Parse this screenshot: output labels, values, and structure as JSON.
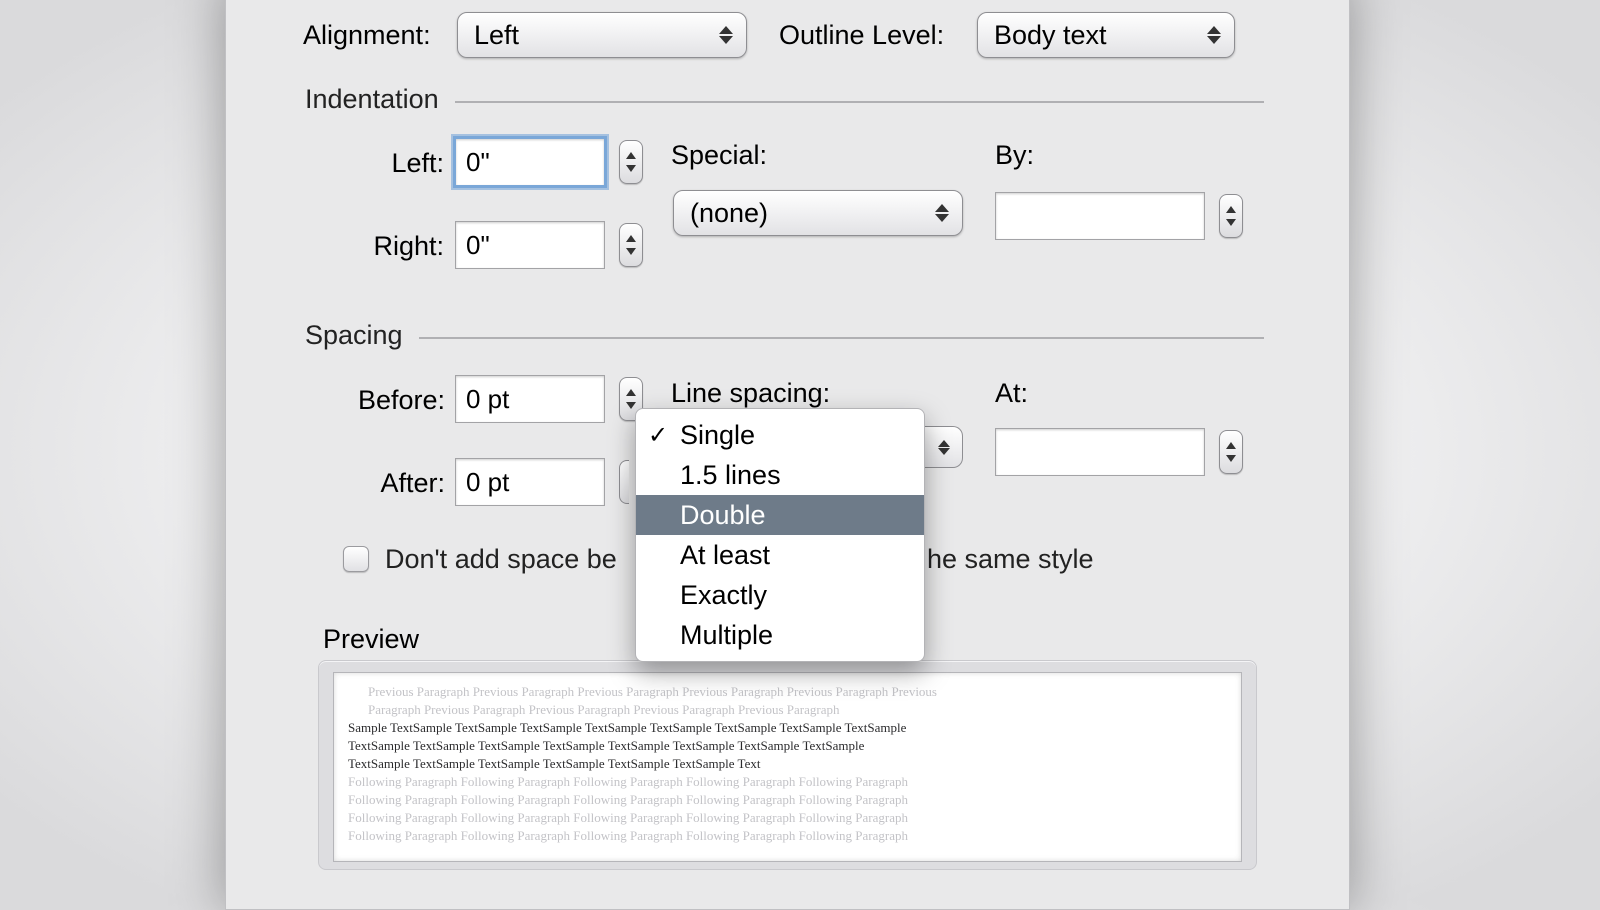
{
  "alignment": {
    "label": "Alignment:",
    "value": "Left"
  },
  "outline_level": {
    "label": "Outline Level:",
    "value": "Body text"
  },
  "sections": {
    "indentation": "Indentation",
    "spacing": "Spacing",
    "preview": "Preview"
  },
  "indentation": {
    "left_label": "Left:",
    "left_value": "0\"",
    "right_label": "Right:",
    "right_value": "0\"",
    "special_label": "Special:",
    "special_value": "(none)",
    "by_label": "By:",
    "by_value": ""
  },
  "spacing": {
    "before_label": "Before:",
    "before_value": "0 pt",
    "after_label": "After:",
    "after_value": "0 pt",
    "line_spacing_label": "Line spacing:",
    "at_label": "At:",
    "at_value": "",
    "line_spacing_selected": "Single",
    "line_spacing_highlighted": "Double",
    "line_spacing_options": [
      "Single",
      "1.5 lines",
      "Double",
      "At least",
      "Exactly",
      "Multiple"
    ],
    "dont_add_space_label": "Don't add space between paragraphs of the same style",
    "dont_add_space_label_visible_left": "Don't add space be",
    "dont_add_space_label_visible_right": "he same style"
  },
  "preview": {
    "ghost": "Previous Paragraph Previous Paragraph Previous Paragraph Previous Paragraph Previous Paragraph Previous",
    "ghost2": "Paragraph Previous Paragraph Previous Paragraph Previous Paragraph Previous Paragraph",
    "main1": "Sample TextSample TextSample TextSample TextSample TextSample TextSample TextSample TextSample",
    "main2": "TextSample TextSample TextSample TextSample TextSample TextSample TextSample TextSample",
    "main3": "TextSample TextSample TextSample TextSample TextSample TextSample Text",
    "follow": "Following Paragraph Following Paragraph Following Paragraph Following Paragraph Following Paragraph"
  }
}
